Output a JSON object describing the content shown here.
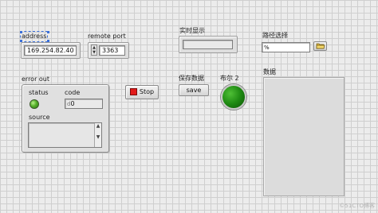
{
  "address": {
    "label": "address",
    "value": "169.254.82.40"
  },
  "remote_port": {
    "label": "remote port",
    "value": "3363"
  },
  "realtime_display": {
    "label": "实时显示",
    "value": ""
  },
  "path_select": {
    "label": "路径选择",
    "value": "",
    "prefix": "%"
  },
  "error_out": {
    "label": "error out",
    "status_label": "status",
    "code_label": "code",
    "code_value": "0",
    "code_prefix": "d",
    "source_label": "source",
    "source_value": ""
  },
  "stop_button": {
    "label": "Stop"
  },
  "save_data": {
    "label": "保存数据",
    "button_text": "save"
  },
  "boolean2": {
    "label": "布尔 2",
    "state_color": "#1e8a12"
  },
  "data_array": {
    "label": "数据"
  },
  "watermark": "©51CTO博客"
}
